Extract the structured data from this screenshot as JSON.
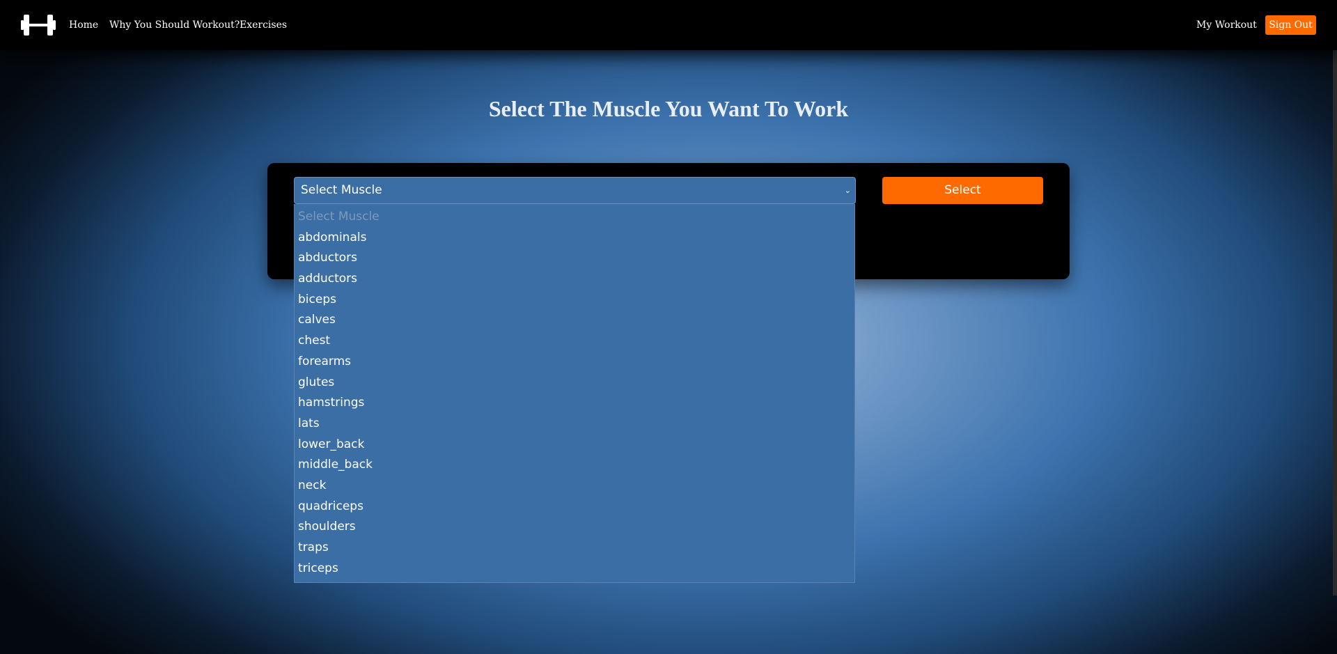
{
  "nav": {
    "links": {
      "home": "Home",
      "why": "Why You Should Workout?",
      "exercises": "Exercises",
      "my_workout": "My Workout"
    },
    "signout_label": "Sign Out",
    "logo_icon": "dumbbell-icon"
  },
  "main": {
    "title": "Select The Muscle You Want To Work",
    "select": {
      "selected_value": "Select Muscle",
      "chevron_icon": "chevron-down-icon",
      "options": [
        "Select Muscle",
        "abdominals",
        "abductors",
        "adductors",
        "biceps",
        "calves",
        "chest",
        "forearms",
        "glutes",
        "hamstrings",
        "lats",
        "lower_back",
        "middle_back",
        "neck",
        "quadriceps",
        "shoulders",
        "traps",
        "triceps"
      ]
    },
    "select_button_label": "Select"
  },
  "colors": {
    "accent": "#ff6a00",
    "select_bg": "#3a6ea5",
    "navbar_bg": "#000000",
    "panel_bg": "#000000"
  }
}
